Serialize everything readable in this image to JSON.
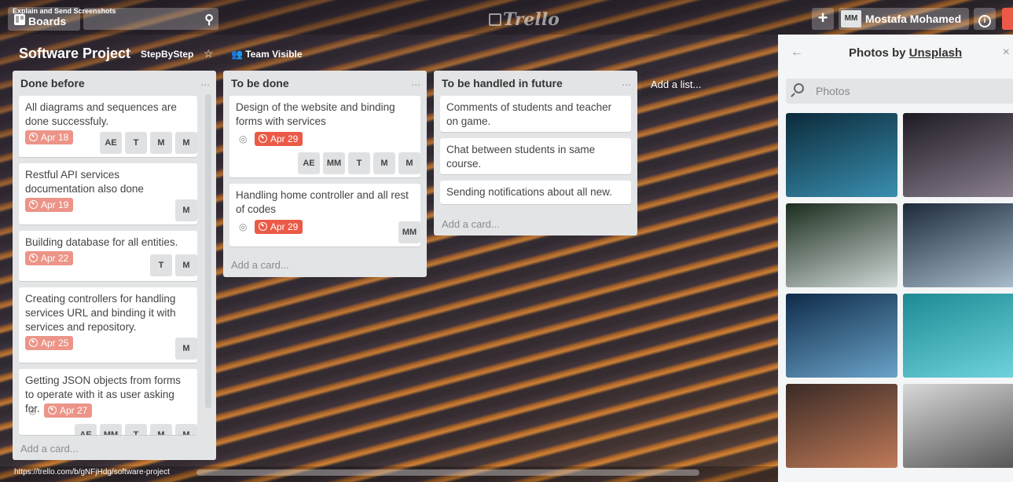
{
  "capture_label": "Explain and Send Screenshots",
  "header": {
    "boards_label": "Boards",
    "logo_text": "Trello",
    "member_initials": "MM",
    "member_name": "Mostafa Mohamed",
    "plus_icon": "plus-icon",
    "info_icon": "info-icon"
  },
  "board": {
    "title": "Software Project",
    "team": "StepByStep",
    "visibility": "Team Visible"
  },
  "lists": [
    {
      "title": "Done before",
      "menu": "...",
      "add_card": "Add a card...",
      "cards": [
        {
          "text": "All diagrams and sequences are done successfuly.",
          "due": "Apr 18",
          "members": [
            "AE",
            "T",
            "M",
            "M"
          ]
        },
        {
          "text": "Restful API services documentation also done",
          "due": "Apr 19",
          "members": [
            "M"
          ]
        },
        {
          "text": "Building database for all entities.",
          "due": "Apr 22",
          "members": [
            "T",
            "M"
          ]
        },
        {
          "text": "Creating controllers for handling services URL and binding it with services and repository.",
          "due": "Apr 25",
          "members": [
            "M"
          ]
        },
        {
          "text": "Getting JSON objects from forms to operate with it as user asking for.",
          "due": "Apr 27",
          "members": [
            "AE",
            "MM",
            "T",
            "M",
            "M"
          ]
        }
      ]
    },
    {
      "title": "To be done",
      "menu": "...",
      "add_card": "Add a card...",
      "cards": [
        {
          "text": "Design of the website and binding forms with services",
          "due": "Apr 29",
          "members": [
            "AE",
            "MM",
            "T",
            "M",
            "M"
          ]
        },
        {
          "text": "Handling home controller and all rest of codes",
          "due": "Apr 29",
          "members": [
            "MM"
          ]
        }
      ]
    },
    {
      "title": "To be handled in future",
      "menu": "...",
      "add_card": "Add a card...",
      "cards": [
        {
          "text": "Comments of students and teacher on game."
        },
        {
          "text": "Chat between students in same course."
        },
        {
          "text": "Sending notifications about all new."
        }
      ]
    }
  ],
  "add_list": "Add a list...",
  "photos_panel": {
    "title_prefix": "Photos by ",
    "title_link": "Unsplash",
    "search_placeholder": "Photos",
    "photos": [
      {
        "name": "underwater-shark",
        "colors": [
          "#0b2a3a",
          "#3a8fb0"
        ]
      },
      {
        "name": "maple-leaves-silhouette",
        "colors": [
          "#1e1a22",
          "#8a7f8e"
        ]
      },
      {
        "name": "coastal-waves",
        "colors": [
          "#1b2d1e",
          "#cfd8d6"
        ]
      },
      {
        "name": "mountain-clouds",
        "colors": [
          "#1c2a3a",
          "#a9bccb"
        ]
      },
      {
        "name": "person-silhouette-sky",
        "colors": [
          "#0f2b4a",
          "#6aa3c8"
        ]
      },
      {
        "name": "divers-turquoise",
        "colors": [
          "#1d8a94",
          "#6fd3dc"
        ]
      },
      {
        "name": "wooden-stripes",
        "colors": [
          "#3a2a26",
          "#c07a58"
        ]
      },
      {
        "name": "statue-of-liberty",
        "colors": [
          "#d8d8d8",
          "#555555"
        ]
      }
    ]
  },
  "status_url": "https://trello.com/b/gNFjHdg/software-project"
}
